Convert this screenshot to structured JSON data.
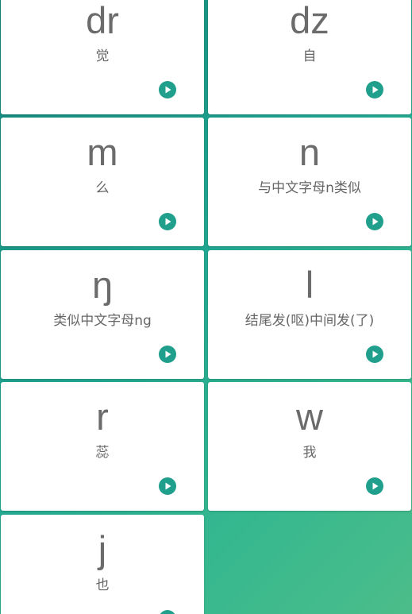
{
  "theme": {
    "accent": "#20a08c",
    "card_background": "#ffffff",
    "text_color": "#6b6b6b",
    "background_gradient": [
      "#12857a",
      "#22a792",
      "#36b88f",
      "#4cbd8a"
    ]
  },
  "cards": [
    {
      "letter": "dr",
      "hint": "觉",
      "play_icon": "play-icon"
    },
    {
      "letter": "dz",
      "hint": "自",
      "play_icon": "play-icon"
    },
    {
      "letter": "m",
      "hint": "么",
      "play_icon": "play-icon"
    },
    {
      "letter": "n",
      "hint": "与中文字母n类似",
      "play_icon": "play-icon"
    },
    {
      "letter": "ŋ",
      "hint": "类似中文字母ng",
      "play_icon": "play-icon"
    },
    {
      "letter": "l",
      "hint": "结尾发(呕)中间发(了)",
      "play_icon": "play-icon"
    },
    {
      "letter": "r",
      "hint": "蕊",
      "play_icon": "play-icon"
    },
    {
      "letter": "w",
      "hint": "我",
      "play_icon": "play-icon"
    },
    {
      "letter": "j",
      "hint": "也",
      "play_icon": "play-icon"
    }
  ]
}
